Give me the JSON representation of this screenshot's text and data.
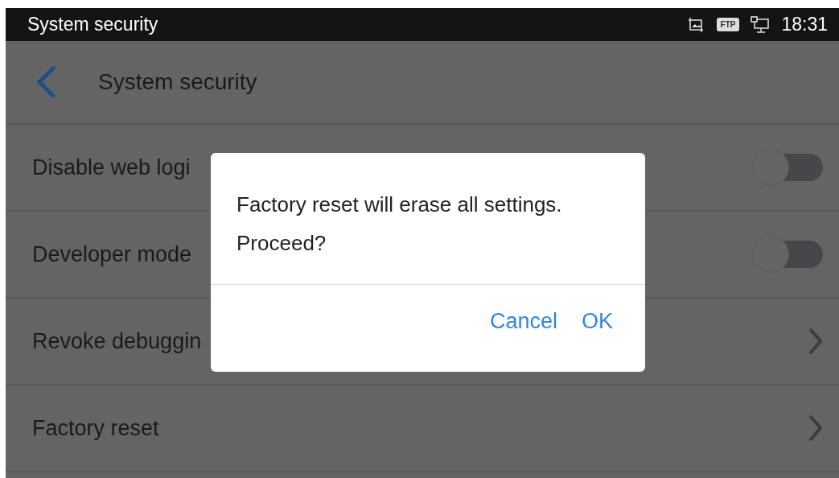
{
  "status_bar": {
    "title": "System security",
    "time": "18:31",
    "badge": "FTP"
  },
  "header": {
    "title": "System security"
  },
  "rows": [
    {
      "label": "Disable web logi",
      "kind": "toggle",
      "on": false
    },
    {
      "label": "Developer mode",
      "kind": "toggle",
      "on": false
    },
    {
      "label": "Revoke debuggin",
      "kind": "link"
    },
    {
      "label": "Factory reset",
      "kind": "link"
    }
  ],
  "dialog": {
    "message": "Factory reset will erase all settings. Proceed?",
    "buttons": [
      "Cancel",
      "OK"
    ]
  }
}
